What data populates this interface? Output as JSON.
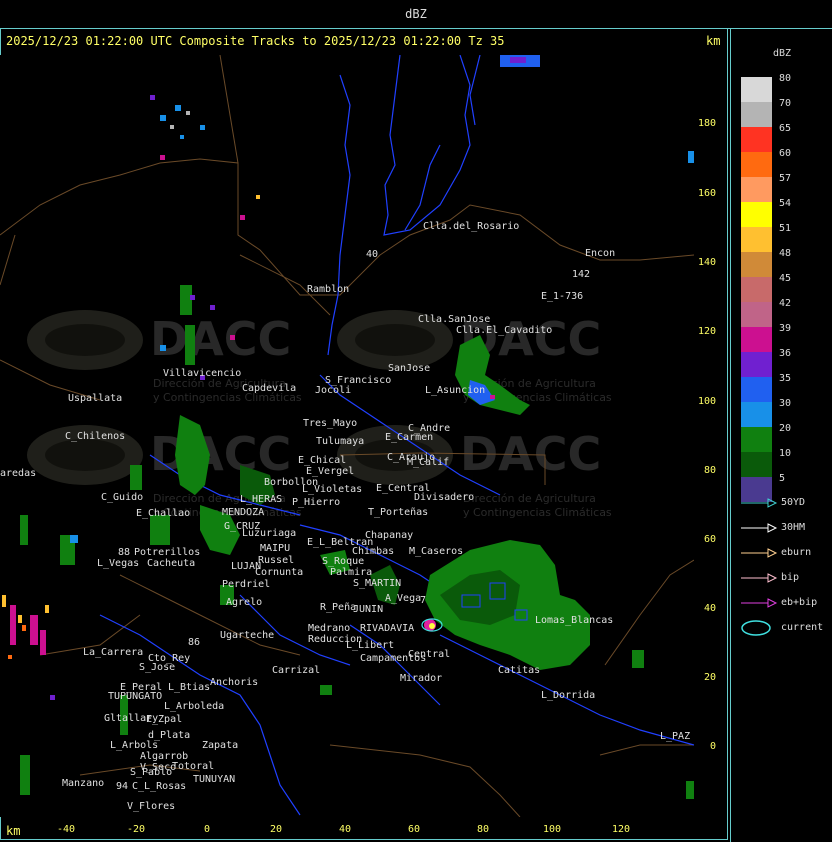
{
  "title": "dBZ",
  "header": "2025/12/23 01:22:00 UTC Composite Tracks to 2025/12/23 01:22:00 Tz 35",
  "unit_top": "km",
  "unit_bottom": "km",
  "legend": {
    "title": "dBZ",
    "scale": [
      {
        "label": "80",
        "color": "#d8d8d8"
      },
      {
        "label": "70",
        "color": "#b4b4b4"
      },
      {
        "label": "65",
        "color": "#ff3322"
      },
      {
        "label": "60",
        "color": "#ff6a10"
      },
      {
        "label": "57",
        "color": "#ff9a60"
      },
      {
        "label": "54",
        "color": "#ffff00"
      },
      {
        "label": "51",
        "color": "#ffc030"
      },
      {
        "label": "48",
        "color": "#d08a38"
      },
      {
        "label": "45",
        "color": "#c86a6a"
      },
      {
        "label": "42",
        "color": "#c06488"
      },
      {
        "label": "39",
        "color": "#cc1090"
      },
      {
        "label": "36",
        "color": "#7020d0"
      },
      {
        "label": "35",
        "color": "#2060f0"
      },
      {
        "label": "30",
        "color": "#1890e8"
      },
      {
        "label": "20",
        "color": "#108010"
      },
      {
        "label": "10",
        "color": "#0a5a0a"
      },
      {
        "label": "5",
        "color": "#4a3a90"
      }
    ],
    "tracks": [
      {
        "label": "50YD",
        "color": "#40d0d0"
      },
      {
        "label": "30HM",
        "color": "#ffffff"
      },
      {
        "label": "eburn",
        "color": "#ffd090"
      },
      {
        "label": "bip",
        "color": "#ffc0d0"
      },
      {
        "label": "eb+bip",
        "color": "#e040e0"
      },
      {
        "label": "current",
        "color": "#40e0e0"
      }
    ]
  },
  "y_axis_ticks": [
    "180",
    "160",
    "140",
    "120",
    "100",
    "80",
    "60",
    "40",
    "20",
    "0"
  ],
  "x_axis_ticks": [
    "-40",
    "-20",
    "0",
    "20",
    "40",
    "60",
    "80",
    "100",
    "120"
  ],
  "watermark": {
    "brand": "DACC",
    "line1": "Dirección de Agricultura",
    "line2": "y Contingencias Climáticas"
  },
  "places": [
    {
      "name": "Clla.del_Rosario"
    },
    {
      "name": "Encon"
    },
    {
      "name": "142"
    },
    {
      "name": "E_1-736"
    },
    {
      "name": "Ramblon"
    },
    {
      "name": "Clla.SanJose"
    },
    {
      "name": "Clla.El_Cavadito"
    },
    {
      "name": "Villavicencio"
    },
    {
      "name": "Capdevila"
    },
    {
      "name": "S_Francisco"
    },
    {
      "name": "SanJose"
    },
    {
      "name": "Jocoli"
    },
    {
      "name": "L_Asuncion"
    },
    {
      "name": "Uspallata"
    },
    {
      "name": "Tres_Mayo"
    },
    {
      "name": "C_Andre"
    },
    {
      "name": "C_Chilenos"
    },
    {
      "name": "Tulumaya"
    },
    {
      "name": "E_Carmen"
    },
    {
      "name": "C_Araujo"
    },
    {
      "name": "M_Calif"
    },
    {
      "name": "E_Chical"
    },
    {
      "name": "E_Vergel"
    },
    {
      "name": "aredas"
    },
    {
      "name": "Borbollon"
    },
    {
      "name": "L_Violetas"
    },
    {
      "name": "E_Central"
    },
    {
      "name": "Divisadero"
    },
    {
      "name": "C_Guido"
    },
    {
      "name": "L_HERAS"
    },
    {
      "name": "P_Hierro"
    },
    {
      "name": "E_Challao"
    },
    {
      "name": "MENDOZA"
    },
    {
      "name": "T_Porteñas"
    },
    {
      "name": "G_CRUZ"
    },
    {
      "name": "Luzuriaga"
    },
    {
      "name": "Chapanay"
    },
    {
      "name": "E_L_Beltran"
    },
    {
      "name": "MAIPU"
    },
    {
      "name": "Chimbas"
    },
    {
      "name": "M_Caseros"
    },
    {
      "name": "Potrerillos"
    },
    {
      "name": "Russel"
    },
    {
      "name": "L_Vegas"
    },
    {
      "name": "Cacheuta"
    },
    {
      "name": "LUJAN"
    },
    {
      "name": "Cornunta"
    },
    {
      "name": "S_Roque"
    },
    {
      "name": "Palmira"
    },
    {
      "name": "Perdriel"
    },
    {
      "name": "S_MARTIN"
    },
    {
      "name": "A_Vega"
    },
    {
      "name": "Agrelo"
    },
    {
      "name": "R_Peña"
    },
    {
      "name": "JUNIN"
    },
    {
      "name": "Lomas_Blancas"
    },
    {
      "name": "Ugarteche"
    },
    {
      "name": "Medrano"
    },
    {
      "name": "Reduccion"
    },
    {
      "name": "RIVADAVIA"
    },
    {
      "name": "La_Carrera"
    },
    {
      "name": "Cto_Rey"
    },
    {
      "name": "L_Libert"
    },
    {
      "name": "Carrizal"
    },
    {
      "name": "S_Jose"
    },
    {
      "name": "Campamentos"
    },
    {
      "name": "Central"
    },
    {
      "name": "Catitas"
    },
    {
      "name": "E_Peral"
    },
    {
      "name": "TUPUNGATO"
    },
    {
      "name": "L_Btias"
    },
    {
      "name": "Anchoris"
    },
    {
      "name": "Mirador"
    },
    {
      "name": "L_Dorrida"
    },
    {
      "name": "L_Arboleda"
    },
    {
      "name": "Gltallary"
    },
    {
      "name": "E_Zpal"
    },
    {
      "name": "L_PAZ"
    },
    {
      "name": "L_Arbols"
    },
    {
      "name": "d_Plata"
    },
    {
      "name": "Zapata"
    },
    {
      "name": "Algarrob"
    },
    {
      "name": "V_Seco"
    },
    {
      "name": "Totoral"
    },
    {
      "name": "TUNUYAN"
    },
    {
      "name": "Manzano"
    },
    {
      "name": "C_L_Rosas"
    },
    {
      "name": "V_Flores"
    },
    {
      "name": "S_Pablo"
    },
    {
      "name": "88"
    },
    {
      "name": "7"
    },
    {
      "name": "40"
    },
    {
      "name": "94"
    },
    {
      "name": "86"
    }
  ]
}
